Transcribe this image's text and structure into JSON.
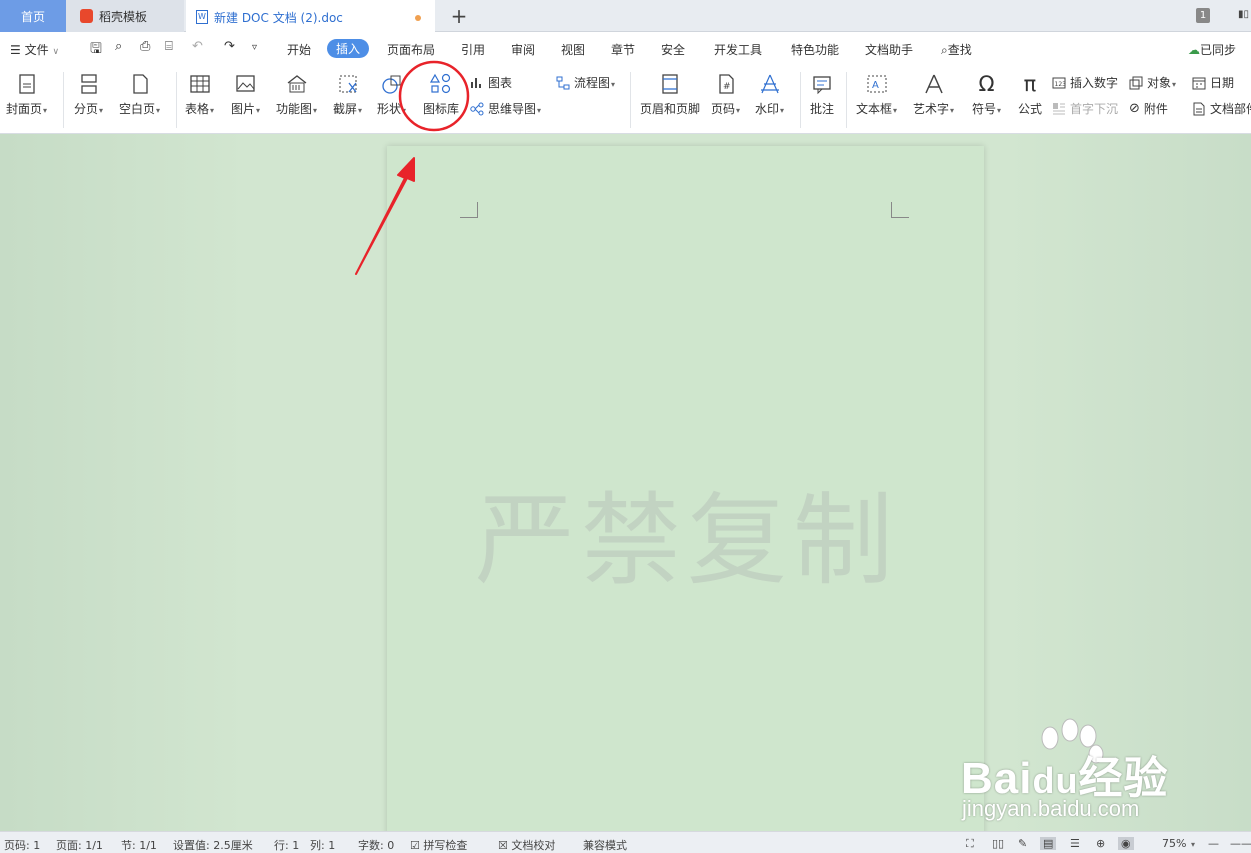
{
  "tabs": {
    "home": "首页",
    "template": "稻壳模板",
    "document": "新建 DOC 文档 (2).doc",
    "new_tab": "+"
  },
  "titlebar": {
    "window_count": "1",
    "control": "▮▯"
  },
  "menu": {
    "file": "文件",
    "items": [
      "开始",
      "插入",
      "页面布局",
      "引用",
      "审阅",
      "视图",
      "章节",
      "安全",
      "开发工具",
      "特色功能",
      "文档助手",
      "查找"
    ],
    "active": "插入",
    "sync": "已同步"
  },
  "ribbon": {
    "cover": "封面页",
    "page_break": "分页",
    "blank_page": "空白页",
    "table": "表格",
    "picture": "图片",
    "function_chart": "功能图",
    "screenshot": "截屏",
    "shape": "形状",
    "icon_library": "图标库",
    "chart": "图表",
    "mind_map": "思维导图",
    "flowchart": "流程图",
    "header_footer": "页眉和页脚",
    "page_number": "页码",
    "watermark": "水印",
    "comment": "批注",
    "textbox": "文本框",
    "wordart": "艺术字",
    "symbol": "符号",
    "formula": "公式",
    "insert_number": "插入数字",
    "drop_cap": "首字下沉",
    "object": "对象",
    "attachment": "附件",
    "date": "日期",
    "doc_parts": "文档部件"
  },
  "document": {
    "watermark": "严禁复制"
  },
  "overlay": {
    "brand": "Bai经验",
    "brand_a": "Bai",
    "brand_b": "du",
    "brand_c": "经验",
    "url": "jingyan.baidu.com"
  },
  "status": {
    "page_code": "页码: 1",
    "pages": "页面: 1/1",
    "section": "节: 1/1",
    "setting": "设置值: 2.5厘米",
    "row": "行: 1",
    "col": "列: 1",
    "words": "字数: 0",
    "spell_check": "拼写检查",
    "proofread": "文档校对",
    "compat": "兼容模式",
    "zoom": "75%"
  },
  "colors": {
    "accent": "#4d8ee6",
    "annotation": "#e8232a",
    "page": "#cfe6cd"
  }
}
